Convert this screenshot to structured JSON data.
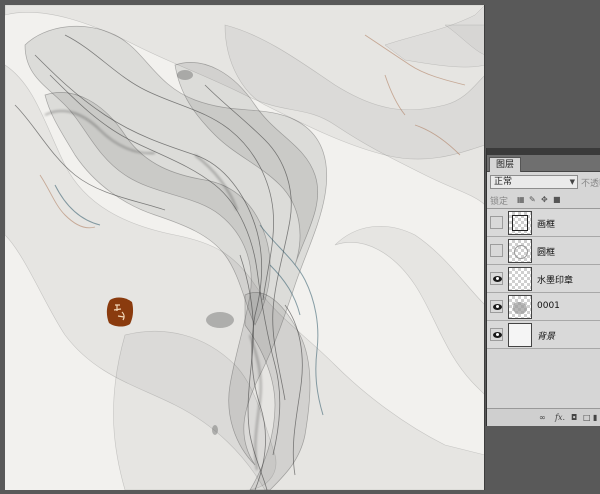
{
  "panel": {
    "tab_label": "图层",
    "blend_mode": "正常",
    "opacity_label": "不透明",
    "lock_label": "锁定"
  },
  "layers": [
    {
      "name": "画框",
      "visible": false,
      "thumb": "frame"
    },
    {
      "name": "圆框",
      "visible": false,
      "thumb": "circle"
    },
    {
      "name": "水墨印章",
      "visible": true,
      "thumb": "transparent"
    },
    {
      "name": "0001",
      "visible": true,
      "thumb": "ink"
    },
    {
      "name": "背景",
      "visible": true,
      "thumb": "solid"
    }
  ],
  "footer": {
    "fx_label": "fx."
  },
  "colors": {
    "canvas_bg": "#f2f1ee",
    "ink_dark": "#3a3a3a",
    "ink_teal": "#2f5a6a",
    "seal_red": "#8a3b0e",
    "panel_bg": "#d6d6d6"
  },
  "icons": [
    "eye-icon",
    "lock-transparency-icon",
    "brush-icon",
    "move-icon",
    "lock-icon",
    "link-icon",
    "fx-icon",
    "mask-icon",
    "new-layer-icon",
    "trash-icon"
  ]
}
